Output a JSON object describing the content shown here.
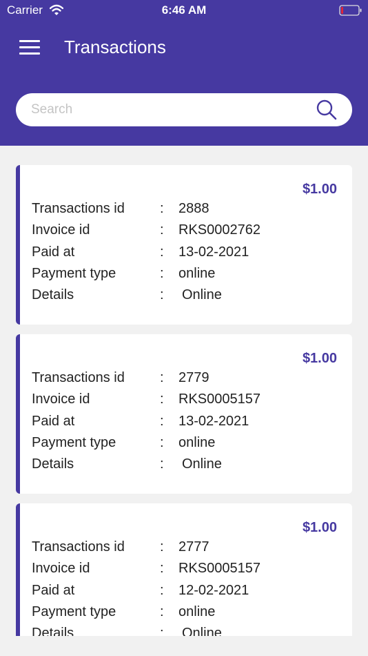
{
  "status_bar": {
    "carrier": "Carrier",
    "time": "6:46 AM"
  },
  "header": {
    "title": "Transactions"
  },
  "search": {
    "placeholder": "Search"
  },
  "labels": {
    "transaction_id": "Transactions id",
    "invoice_id": "Invoice id",
    "paid_at": "Paid at",
    "payment_type": "Payment type",
    "details": "Details",
    "separator": ":"
  },
  "transactions": [
    {
      "amount": "$1.00",
      "transaction_id": "2888",
      "invoice_id": "RKS0002762",
      "paid_at": "13-02-2021",
      "payment_type": "online",
      "details": "Online"
    },
    {
      "amount": "$1.00",
      "transaction_id": "2779",
      "invoice_id": "RKS0005157",
      "paid_at": "13-02-2021",
      "payment_type": "online",
      "details": "Online"
    },
    {
      "amount": "$1.00",
      "transaction_id": "2777",
      "invoice_id": "RKS0005157",
      "paid_at": "12-02-2021",
      "payment_type": "online",
      "details": "Online"
    }
  ],
  "colors": {
    "primary": "#4639a1",
    "background": "#f1f1f1",
    "card": "#ffffff"
  }
}
